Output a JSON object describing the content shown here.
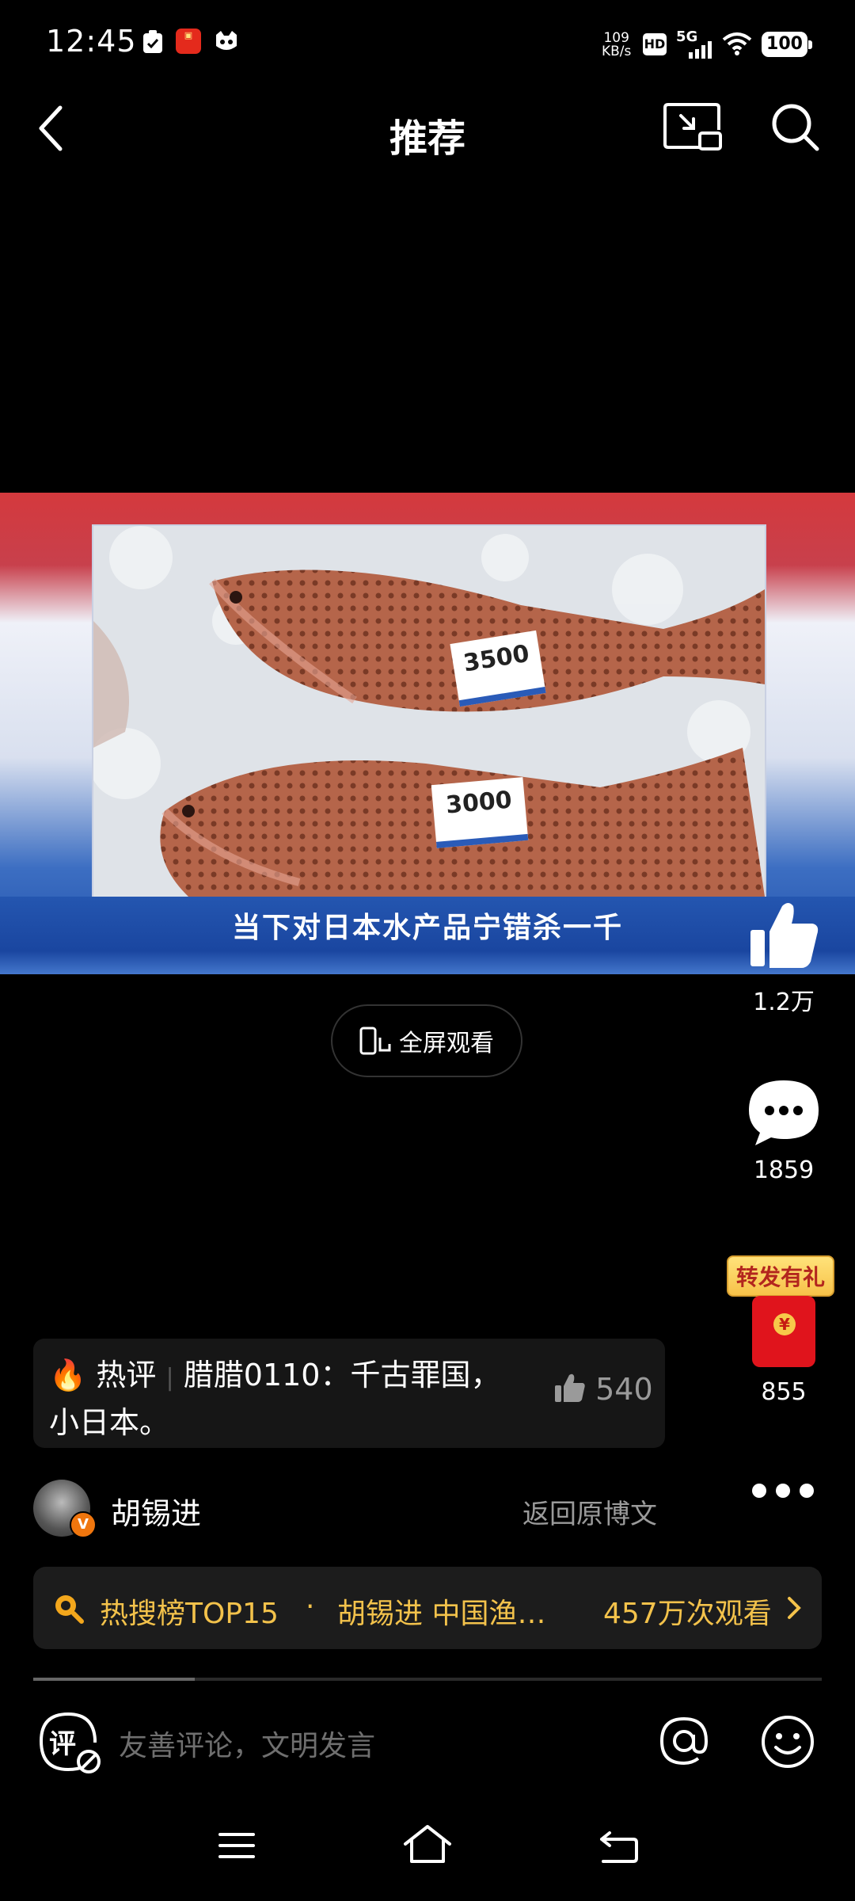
{
  "status_bar": {
    "time": "12:45",
    "net_speed_value": "109",
    "net_speed_unit": "KB/s",
    "hd": "HD",
    "signal": "5G",
    "battery": "100",
    "icons": [
      "notification-icon",
      "app-icon",
      "cat-icon",
      "wifi-icon",
      "signal-icon"
    ]
  },
  "header": {
    "title": "推荐",
    "icons": [
      "back-icon",
      "cast-icon",
      "search-icon"
    ]
  },
  "video": {
    "subtitle": "当下对日本水产品宁错杀一千",
    "price_tags": [
      "3500",
      "3000"
    ],
    "fullscreen_label": "全屏观看"
  },
  "actions": {
    "likes": "1.2万",
    "comments": "1859",
    "share_badge": "转发有礼",
    "shares": "855"
  },
  "hot_comment": {
    "tag": "热评",
    "user": "腊腊0110",
    "text_line1": "：千古罪国，",
    "text_line2": "小日本。",
    "likes": "540"
  },
  "author": {
    "name": "胡锡进",
    "badge": "V",
    "back_link": "返回原博文"
  },
  "hot_search": {
    "rank": "热搜榜TOP15",
    "separator": "·",
    "topic": "胡锡进 中国渔…",
    "views": "457万次观看"
  },
  "progress": {
    "fraction": 0.205
  },
  "comment_bar": {
    "icon_char": "评",
    "placeholder": "友善评论，文明发言"
  },
  "colors": {
    "background": "#000000",
    "accent_gold": "#f3c24b",
    "muted_text": "#9a9a9a"
  }
}
